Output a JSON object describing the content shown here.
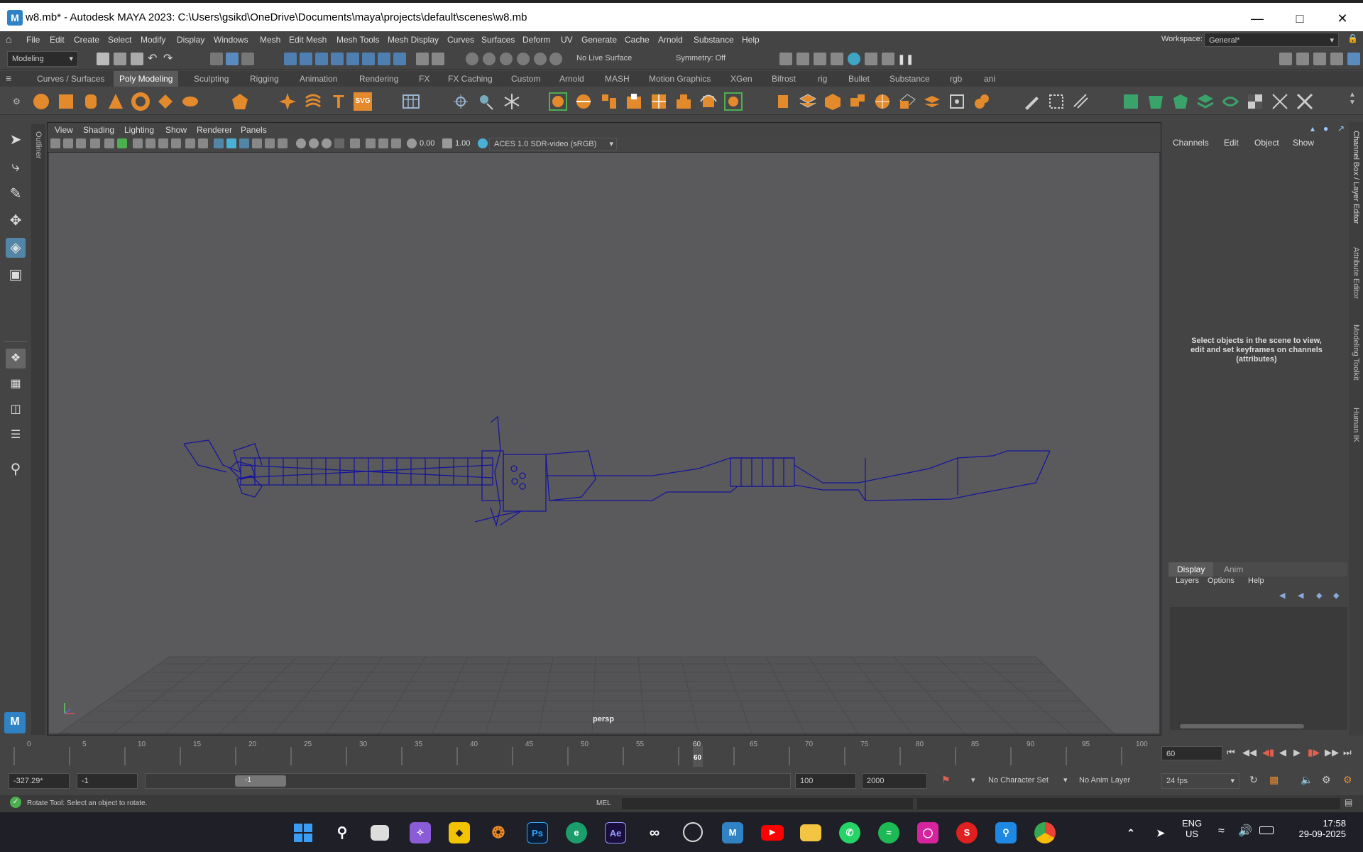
{
  "window": {
    "title": "w8.mb* - Autodesk MAYA 2023: C:\\Users\\gsikd\\OneDrive\\Documents\\maya\\projects\\default\\scenes\\w8.mb",
    "logo": "M"
  },
  "menubar": {
    "items": [
      "File",
      "Edit",
      "Create",
      "Select",
      "Modify",
      "Display",
      "Windows",
      "Mesh",
      "Edit Mesh",
      "Mesh Tools",
      "Mesh Display",
      "Curves",
      "Surfaces",
      "Deform",
      "UV",
      "Generate",
      "Cache",
      "Arnold",
      "Substance",
      "Help"
    ],
    "workspace_label": "Workspace:",
    "workspace_value": "General*"
  },
  "statusline": {
    "mode": "Modeling",
    "live_surface": "No Live Surface",
    "symmetry": "Symmetry: Off"
  },
  "shelf_tabs": [
    "Curves / Surfaces",
    "Poly Modeling",
    "Sculpting",
    "Rigging",
    "Animation",
    "Rendering",
    "FX",
    "FX Caching",
    "Custom",
    "Arnold",
    "MASH",
    "Motion Graphics",
    "XGen",
    "Bifrost",
    "rig",
    "Bullet",
    "Substance",
    "rgb",
    "ani"
  ],
  "shelf_active": "Poly Modeling",
  "viewport": {
    "menu": [
      "View",
      "Shading",
      "Lighting",
      "Show",
      "Renderer",
      "Panels"
    ],
    "exposure": "0.00",
    "gamma": "1.00",
    "colorspace": "ACES 1.0 SDR-video (sRGB)",
    "camera_label": "persp"
  },
  "outliner_label": "Outliner",
  "channel_box": {
    "menu": [
      "Channels",
      "Edit",
      "Object",
      "Show"
    ],
    "empty_msg": "Select objects in the scene to view, edit and set keyframes on channels (attributes)"
  },
  "layer_editor": {
    "tabs": [
      "Display",
      "Anim"
    ],
    "menu": [
      "Layers",
      "Options",
      "Help"
    ]
  },
  "side_tabs": [
    "Channel Box / Layer Editor",
    "Attribute Editor",
    "Modeling Toolkit",
    "Human IK"
  ],
  "timeline": {
    "ticks": [
      "0",
      "5",
      "10",
      "15",
      "20",
      "25",
      "30",
      "35",
      "40",
      "45",
      "50",
      "55",
      "60",
      "65",
      "70",
      "75",
      "80",
      "85",
      "90",
      "95",
      "100"
    ],
    "current_frame": "60",
    "current_frame_field": "60"
  },
  "range": {
    "start": "-327.29*",
    "start2": "-1",
    "slider_label": "-1",
    "end": "100",
    "end2": "2000",
    "character_set": "No Character Set",
    "anim_layer": "No Anim Layer",
    "fps": "24 fps"
  },
  "cmdline": {
    "help": "Rotate Tool: Select an object to rotate.",
    "mel": "MEL"
  },
  "taskbar": {
    "lang1": "ENG",
    "lang2": "US",
    "time": "17:58",
    "date": "29-09-2025"
  }
}
